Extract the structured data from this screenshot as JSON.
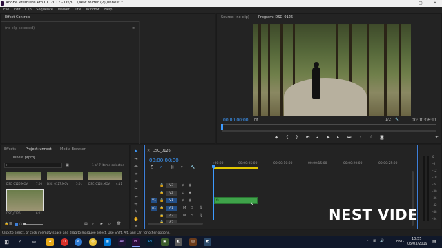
{
  "window": {
    "title": "Adobe Premiere Pro CC 2017 - D:\\Bi C\\New folder (2)\\unnest *"
  },
  "menu": [
    "File",
    "Edit",
    "Clip",
    "Sequence",
    "Marker",
    "Title",
    "Window",
    "Help"
  ],
  "effect_controls": {
    "tab": "Effect Controls",
    "tab_menu": "≡",
    "no_clip": "(no clip selected)"
  },
  "source_monitor": {
    "tab": "Source: (no clip)"
  },
  "program_monitor": {
    "tab": "Program: DSC_0126",
    "timecode": "00:00:00:00",
    "fit": "Fit",
    "page": "1/2",
    "duration": "00:00:06:11"
  },
  "project": {
    "tabs": [
      "Effects",
      "Project: unnest",
      "Media Browser"
    ],
    "file": "unnest.prproj",
    "count": "1 of 7 items selected",
    "clips": [
      {
        "name": "DSC_0126.MOV",
        "dur": "7:00"
      },
      {
        "name": "DSC_0127.MOV",
        "dur": "5:01"
      },
      {
        "name": "DSC_0128.MOV",
        "dur": "4:11"
      },
      {
        "name": "DSC_0126",
        "dur": "6:11"
      }
    ]
  },
  "timeline": {
    "tab": "DSC_0126",
    "timecode": "00:00:00:00",
    "ruler": [
      ":00:00",
      "00:00:05:00",
      "00:00:10:00",
      "00:00:15:00",
      "00:00:20:00",
      "00:00:25:00"
    ],
    "tracks": [
      {
        "name": "V3",
        "target": "V3"
      },
      {
        "name": "V2",
        "target": "V2"
      },
      {
        "name": "V1",
        "target": "V1",
        "source": "V1"
      },
      {
        "name": "A1",
        "target": "A1",
        "source": "A1"
      },
      {
        "name": "A2",
        "target": "A2"
      },
      {
        "name": "A3",
        "target": "A3"
      }
    ],
    "clip_label": "fx"
  },
  "meter": {
    "labels": [
      "0",
      "-6",
      "-12",
      "-18",
      "-24",
      "-30",
      "-36",
      "-42",
      "-48",
      "-54"
    ]
  },
  "status": "Click to select, or click in empty space and drag to marquee select. Use Shift, Alt, and Ctrl for other options.",
  "watermark": "NEST VIDEO",
  "taskbar": {
    "lang": "ENG",
    "time": "10:55",
    "date": "05/03/2019",
    "apps": [
      "Pr",
      "Ae",
      "Ps"
    ]
  },
  "colors": {
    "accent": "#3d9bff",
    "clip": "#3fa34a",
    "work_area": "#e3c700",
    "taskbar": "#10182a"
  }
}
